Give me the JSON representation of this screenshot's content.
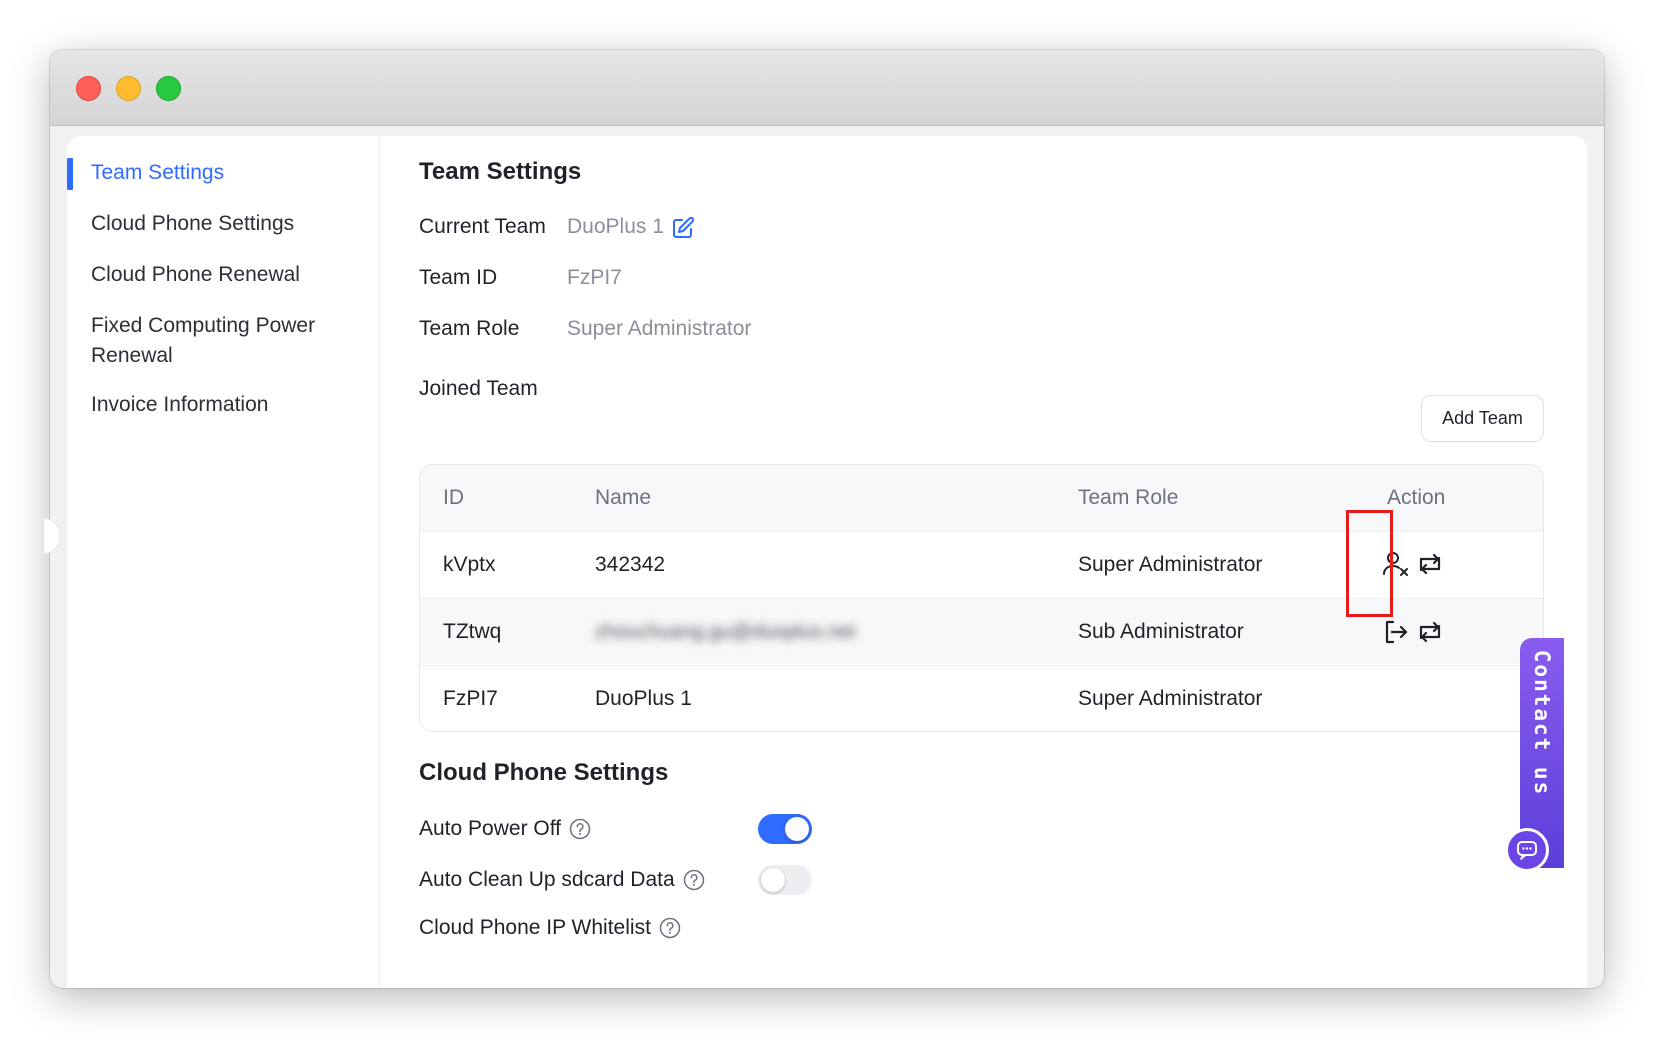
{
  "sidebar": {
    "items": [
      {
        "label": "Team Settings",
        "active": true
      },
      {
        "label": "Cloud Phone Settings"
      },
      {
        "label": "Cloud Phone Renewal"
      },
      {
        "label": "Fixed Computing Power Renewal"
      },
      {
        "label": "Invoice Information"
      }
    ]
  },
  "team_settings": {
    "title": "Team Settings",
    "current_team_label": "Current Team",
    "current_team_value": "DuoPlus 1",
    "team_id_label": "Team ID",
    "team_id_value": "FzPI7",
    "team_role_label": "Team Role",
    "team_role_value": "Super Administrator",
    "joined_team_label": "Joined Team",
    "add_team_button": "Add Team"
  },
  "joined_table": {
    "headers": {
      "id": "ID",
      "name": "Name",
      "role": "Team Role",
      "action": "Action"
    },
    "rows": [
      {
        "id": "kVptx",
        "name": "342342",
        "role": "Super Administrator",
        "actions": [
          "remove-user-icon",
          "switch-icon"
        ]
      },
      {
        "id": "TZtwq",
        "name": "zhouchuang.gu@duoplus.net",
        "role": "Sub Administrator",
        "actions": [
          "exit-icon",
          "switch-icon"
        ]
      },
      {
        "id": "FzPI7",
        "name": "DuoPlus 1",
        "role": "Super Administrator",
        "actions": []
      }
    ]
  },
  "cloud_phone_settings": {
    "title": "Cloud Phone Settings",
    "auto_power_off": {
      "label": "Auto Power Off",
      "enabled": true
    },
    "auto_clean": {
      "label": "Auto Clean Up sdcard Data",
      "enabled": false
    },
    "ip_whitelist": {
      "label": "Cloud Phone IP Whitelist"
    }
  },
  "contact": {
    "label": "Contact us"
  },
  "colors": {
    "accent": "#2f6bff",
    "highlight": "#e81b1b",
    "contact": "#6b45e6"
  }
}
